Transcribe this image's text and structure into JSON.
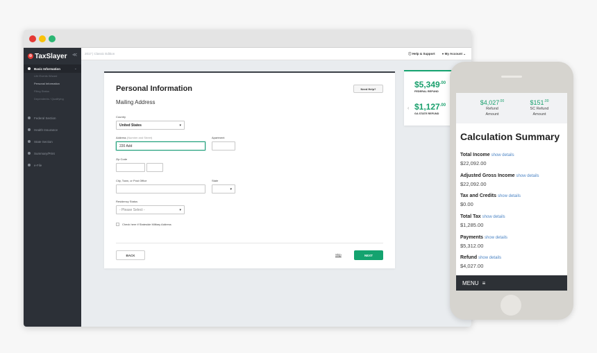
{
  "app": {
    "name": "TaxSlayer",
    "edition": "2017 | Classic Edition",
    "collapse_icon": "≪"
  },
  "topbar": {
    "help": "ⓘ Help & Support",
    "account": "● My Account ⌄"
  },
  "sidebar": {
    "sections": [
      {
        "label": "Basic Information",
        "icon": "user-icon",
        "active": true
      },
      {
        "label": "Federal Section",
        "icon": "circle-icon"
      },
      {
        "label": "Health Insurance",
        "icon": "circle-icon"
      },
      {
        "label": "State Section",
        "icon": "circle-icon"
      },
      {
        "label": "Summary/Print",
        "icon": "circle-icon"
      },
      {
        "label": "e-File",
        "icon": "circle-icon"
      }
    ],
    "subitems": [
      "Life Events Wizard",
      "Personal Information",
      "Filing Status",
      "Dependents / Qualifying"
    ]
  },
  "form": {
    "title": "Personal Information",
    "subtitle": "Mailing Address",
    "help_button": "Need Help?",
    "country_label": "Country",
    "country_value": "United States",
    "address_label": "Address",
    "address_hint": "(Number and Street)",
    "address_value": "220 Add",
    "apartment_label": "Apartment",
    "zip_label": "Zip Code",
    "city_label": "City, Town, or Post Office",
    "state_label": "State",
    "residency_label": "Residency Status",
    "residency_value": "- Please Select -",
    "military_label": "Check here if Stateside Military Address",
    "back": "BACK",
    "skip": "Skip",
    "next": "NEXT"
  },
  "refunds": {
    "federal_amount": "$5,349",
    "federal_cents": ".00",
    "federal_label": "FEDERAL REFUND",
    "state_amount": "$1,127",
    "state_cents": ".00",
    "state_label": "GA STATE REFUND"
  },
  "phone": {
    "refund_amount": "$4,027",
    "refund_cents": ".00",
    "refund_cap1": "Refund",
    "refund_cap2": "Amount",
    "sc_amount": "$151",
    "sc_cents": ".00",
    "sc_cap1": "SC Refund",
    "sc_cap2": "Amount",
    "calc_title": "Calculation Summary",
    "show_details": "show details",
    "rows": [
      {
        "label": "Total Income",
        "value": "$22,092.00"
      },
      {
        "label": "Adjusted Gross Income",
        "value": "$22,092.00"
      },
      {
        "label": "Tax and Credits",
        "value": "$0.00"
      },
      {
        "label": "Total Tax",
        "value": "$1,285.00"
      },
      {
        "label": "Payments",
        "value": "$5,312.00"
      },
      {
        "label": "Refund",
        "value": "$4,027.00"
      }
    ],
    "menu": "MENU"
  },
  "colors": {
    "accent": "#14a36f",
    "brand_red": "#e53935",
    "sidebar": "#2c3037"
  }
}
